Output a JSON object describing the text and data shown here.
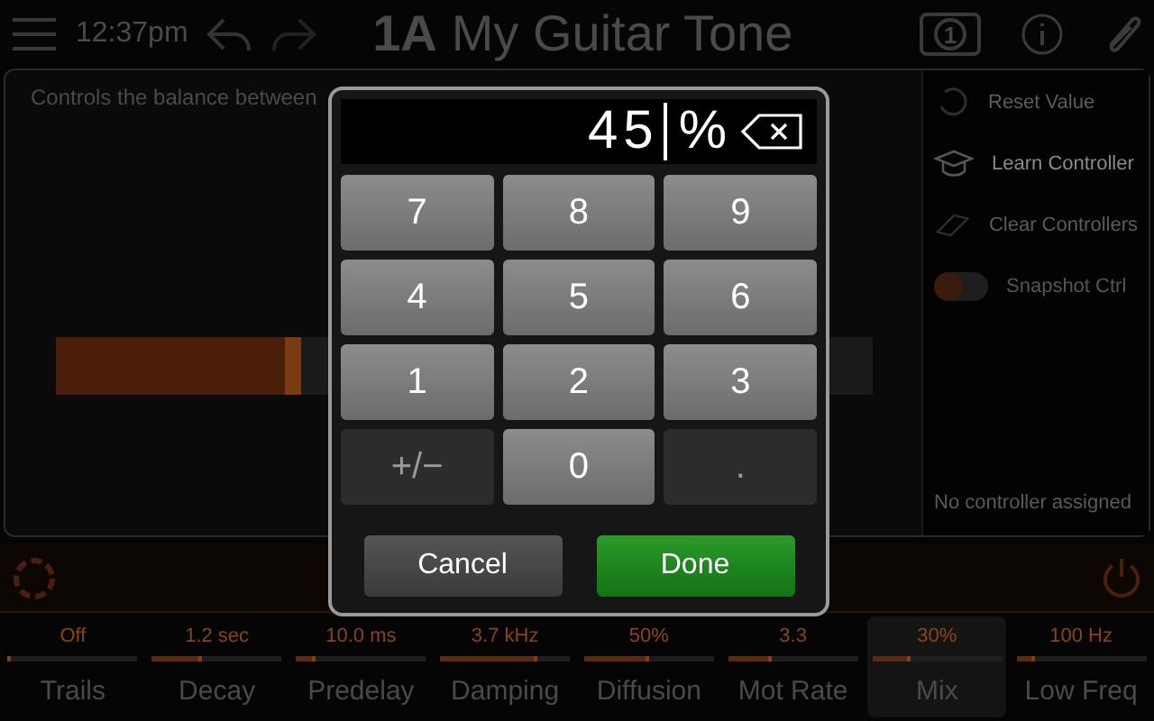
{
  "top_bar": {
    "time": "12:37pm",
    "preset_number": "1A",
    "preset_name": "My Guitar Tone",
    "snapshot": "1"
  },
  "description": "Controls the balance between",
  "main_slider": {
    "level": 0.3
  },
  "side_menu": {
    "items": [
      {
        "kind": "reset",
        "label": "Reset Value",
        "disabled": true
      },
      {
        "kind": "learn",
        "label": "Learn Controller",
        "disabled": false
      },
      {
        "kind": "clear",
        "label": "Clear Controllers",
        "disabled": true
      },
      {
        "kind": "toggle",
        "label": "Snapshot Ctrl",
        "on": false
      }
    ],
    "footer": "No controller assigned"
  },
  "params": [
    {
      "label": "Trails",
      "value": "Off",
      "level": 0.0,
      "selected": false
    },
    {
      "label": "Decay",
      "value": "1.2 sec",
      "level": 0.38,
      "selected": false
    },
    {
      "label": "Predelay",
      "value": "10.0 ms",
      "level": 0.15,
      "selected": false
    },
    {
      "label": "Damping",
      "value": "3.7 kHz",
      "level": 0.75,
      "selected": false
    },
    {
      "label": "Diffusion",
      "value": "50%",
      "level": 0.5,
      "selected": false
    },
    {
      "label": "Mot Rate",
      "value": "3.3",
      "level": 0.33,
      "selected": false
    },
    {
      "label": "Mix",
      "value": "30%",
      "level": 0.3,
      "selected": true
    },
    {
      "label": "Low Freq",
      "value": "100 Hz",
      "level": 0.15,
      "selected": false
    }
  ],
  "keypad": {
    "value": "45",
    "unit": "%",
    "keys": [
      {
        "label": "7",
        "kind": "digit"
      },
      {
        "label": "8",
        "kind": "digit"
      },
      {
        "label": "9",
        "kind": "digit"
      },
      {
        "label": "4",
        "kind": "digit"
      },
      {
        "label": "5",
        "kind": "digit"
      },
      {
        "label": "6",
        "kind": "digit"
      },
      {
        "label": "1",
        "kind": "digit"
      },
      {
        "label": "2",
        "kind": "digit"
      },
      {
        "label": "3",
        "kind": "digit"
      },
      {
        "label": "+/−",
        "kind": "symbol"
      },
      {
        "label": "0",
        "kind": "digit"
      },
      {
        "label": ".",
        "kind": "symbol"
      }
    ],
    "buttons": [
      {
        "label": "Cancel",
        "kind": "cancel"
      },
      {
        "label": "Done",
        "kind": "confirm"
      }
    ]
  }
}
